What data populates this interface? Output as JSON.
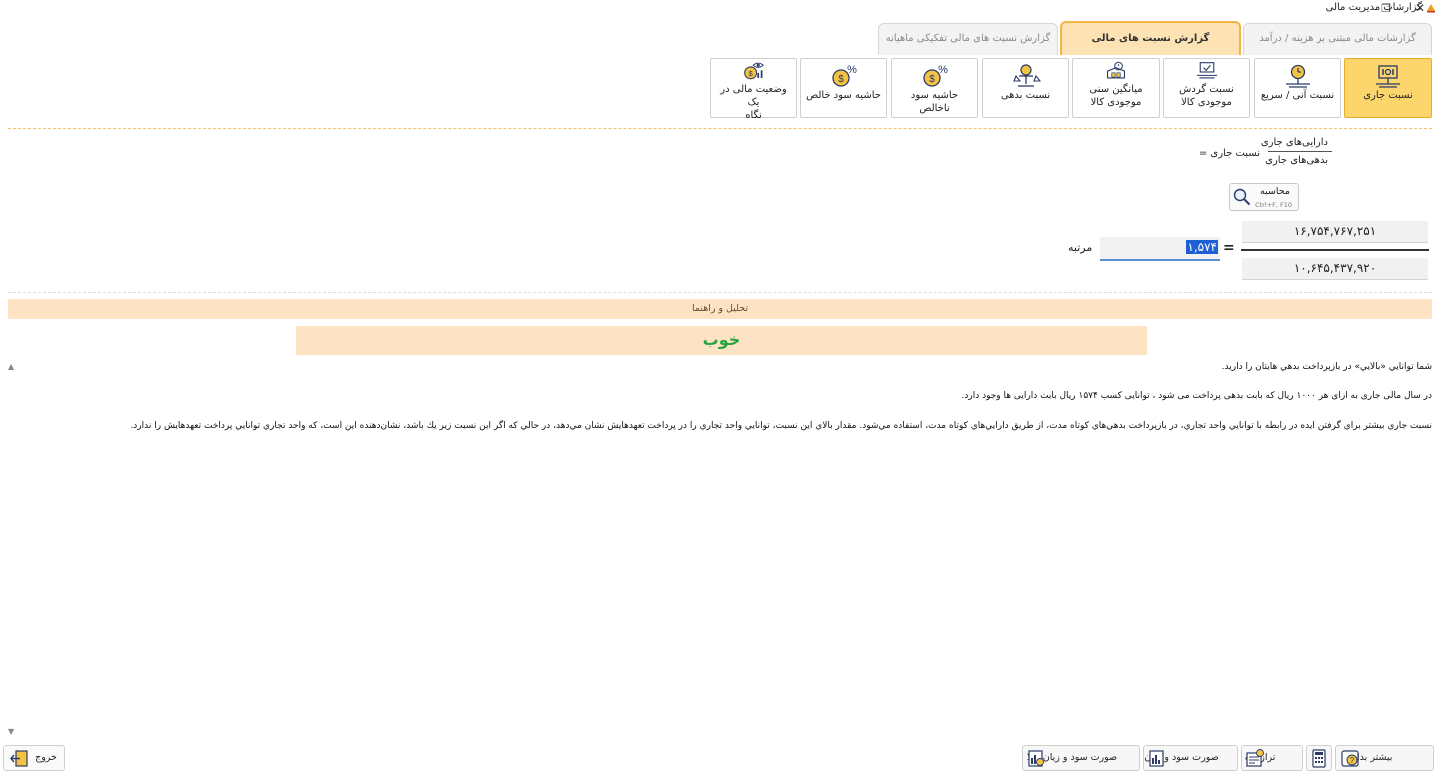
{
  "window": {
    "title": "گزارشات مدیریت مالی",
    "restore_glyph": "❐",
    "close_glyph": "✕"
  },
  "tabs": [
    {
      "label": "گزارشات مالی مبتنی بر هزینه / درآمد",
      "active": false
    },
    {
      "label": "گزارش نسبت های مالی",
      "active": true
    },
    {
      "label": "گزارش نسبت های مالی تفکیکی ماهیانه",
      "active": false
    }
  ],
  "ratio_buttons": [
    {
      "line1": "نسبت جاری",
      "line2": "",
      "icon": "scale-icon",
      "active": true
    },
    {
      "line1": "نسبت آنی / سریع",
      "line2": "",
      "icon": "clock-scale-icon",
      "active": false
    },
    {
      "line1": "نسبت گردش",
      "line2": "موجودی کالا",
      "icon": "inventory-turnover-icon",
      "active": false
    },
    {
      "line1": "میانگین سنی",
      "line2": "موجودی کالا",
      "icon": "inventory-age-icon",
      "active": false
    },
    {
      "line1": "نسبت بدهی",
      "line2": "",
      "icon": "debt-scale-icon",
      "active": false
    },
    {
      "line1": "حاشیه سود ناخالص",
      "line2": "",
      "icon": "percent-coin-icon",
      "active": false
    },
    {
      "line1": "حاشیه سود خالص",
      "line2": "",
      "icon": "percent-coin-icon",
      "active": false
    },
    {
      "line1": "وضعیت مالی در یک",
      "line2": "نگاه",
      "icon": "eye-coin-icon",
      "active": false
    }
  ],
  "formula": {
    "lhs": "نسبت جاری =",
    "numerator": "دارایی‌های جاری",
    "denominator": "بدهی‌های جاری"
  },
  "calculate": {
    "label": "محاسبه",
    "shortcut": "Ctrl+F, F10"
  },
  "calc_values": {
    "numerator": "۱۶,۷۵۴,۷۶۷,۲۵۱",
    "denominator": "۱۰,۶۴۵,۴۳۷,۹۲۰",
    "equals": "=",
    "result": "۱,۵۷۴",
    "unit": "مرتبه"
  },
  "analysis": {
    "header": "تحلیل و راهنما",
    "verdict": "خوب",
    "verdict_color": "#2aa33f",
    "paragraphs": [
      "شما توانايي «بالايي» در بازپرداخت بدهي هايتان را داريد.",
      "در سال مالی جاری به ازای هر ۱۰۰۰ ریال که بابت بدهی پرداخت می شود ، توانایی کسب ۱۵۷۴ ریال بابت دارایی ها وجود دارد.",
      "نسبت جاري بيشتر براي گرفتن ايده در رابطه با توانايي واحد تجاري، در بازپرداخت بدهي‌هاي كوتاه مدت، از طريق دارايي‌هاي كوتاه مدت، استفاده مي‌شود. مقدار بالاي اين نسبت، توانايي واحد تجاري را در پرداخت تعهدهايش نشان مي‌دهد، در حالي كه اگر اين نسبت زير يك باشد، نشان‌دهنده اين است، كه واحد تجاري توانايي پرداخت تعهدهايش را ندارد."
    ]
  },
  "bottom": {
    "more_info": "بیشتر بدانید",
    "balance_sheet": "ترازنامه",
    "income_statement": "صورت سود و زیان",
    "goods_income_statement": "صورت سود و زیان کالا",
    "exit": "خروج"
  },
  "colors": {
    "accent": "#fcd66d",
    "tab_active": "#fde3b4",
    "analysis_bg": "#fde3c4",
    "selection": "#1e5fd3"
  }
}
